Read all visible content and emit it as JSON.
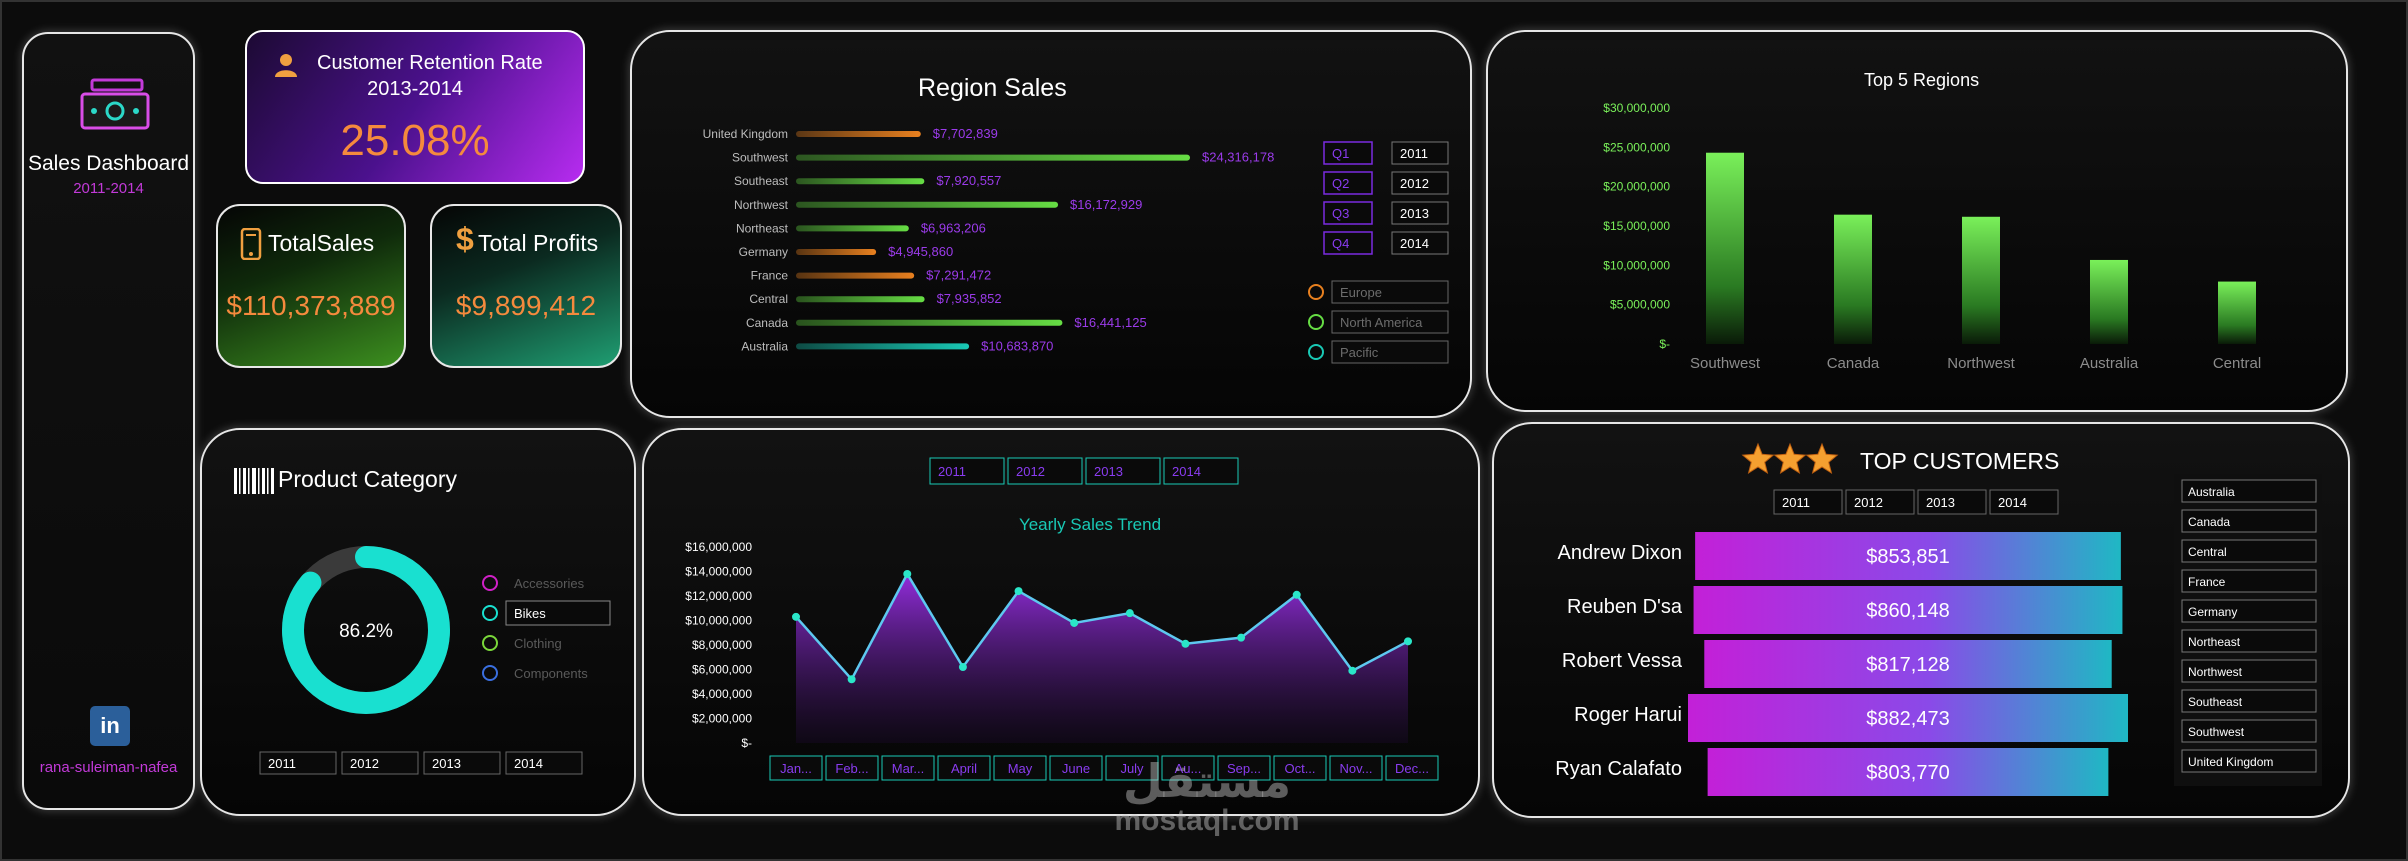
{
  "sidebar": {
    "title": "Sales Dashboard",
    "years": "2011-2014",
    "linkedin": "in",
    "user": "rana-suleiman-nafea"
  },
  "kpis": {
    "retention": {
      "title": "Customer Retention Rate",
      "sub": "2013-2014",
      "value": "25.08%"
    },
    "sales": {
      "title": "TotalSales",
      "value": "$110,373,889"
    },
    "profits": {
      "title": "Total Profits",
      "value": "$9,899,412"
    }
  },
  "colors": {
    "purple": "#8a2be2",
    "green": "#66dd44",
    "orange": "#e8801f",
    "teal": "#19c9b5",
    "accent_text": "#9b3bea"
  },
  "chart_data": [
    {
      "id": "region-sales",
      "type": "bar",
      "orientation": "horizontal",
      "title": "Region Sales",
      "categories": [
        "United Kingdom",
        "Southwest",
        "Southeast",
        "Northwest",
        "Northeast",
        "Germany",
        "France",
        "Central",
        "Canada",
        "Australia"
      ],
      "values": [
        7702839,
        24316178,
        7920557,
        16172929,
        6963206,
        4945860,
        7291472,
        7935852,
        16441125,
        10683870
      ],
      "labels": [
        "$7,702,839",
        "$24,316,178",
        "$7,920,557",
        "$16,172,929",
        "$6,963,206",
        "$4,945,860",
        "$7,291,472",
        "$7,935,852",
        "$16,441,125",
        "$10,683,870"
      ],
      "groups": [
        "Europe",
        "North America",
        "North America",
        "North America",
        "North America",
        "Europe",
        "Europe",
        "North America",
        "North America",
        "Pacific"
      ],
      "group_colors": {
        "Europe": "#e8801f",
        "North America": "#66dd44",
        "Pacific": "#19c9b5"
      },
      "slicers": {
        "quarters": [
          "Q1",
          "Q2",
          "Q3",
          "Q4"
        ],
        "years": [
          "2011",
          "2012",
          "2013",
          "2014"
        ],
        "groups": [
          "Europe",
          "North America",
          "Pacific"
        ]
      }
    },
    {
      "id": "top5",
      "type": "bar",
      "title": "Top 5 Regions",
      "categories": [
        "Southwest",
        "Canada",
        "Northwest",
        "Australia",
        "Central"
      ],
      "values": [
        24316178,
        16441125,
        16172929,
        10683870,
        7935852
      ],
      "y_ticks": [
        "$30,000,000",
        "$25,000,000",
        "$20,000,000",
        "$15,000,000",
        "$10,000,000",
        "$5,000,000",
        "$-"
      ],
      "ylim": [
        0,
        30000000
      ]
    },
    {
      "id": "product",
      "type": "pie",
      "title": "Product Category",
      "center_label": "86.2%",
      "value": 86.2,
      "legend": [
        "Accessories",
        "Bikes",
        "Clothing",
        "Components"
      ],
      "legend_colors": [
        "#d020c8",
        "#19e0d0",
        "#7ad83a",
        "#3a6fe0"
      ],
      "selected": "Bikes",
      "years": [
        "2011",
        "2012",
        "2013",
        "2014"
      ]
    },
    {
      "id": "yearly",
      "type": "area",
      "title": "Yearly Sales Trend",
      "categories": [
        "Jan...",
        "Feb...",
        "Mar...",
        "April",
        "May",
        "June",
        "July",
        "Au...",
        "Sep...",
        "Oct...",
        "Nov...",
        "Dec..."
      ],
      "values": [
        10300000,
        5200000,
        13800000,
        6200000,
        12400000,
        9800000,
        10600000,
        8100000,
        8600000,
        12100000,
        5900000,
        8300000
      ],
      "y_ticks": [
        "$16,000,000",
        "$14,000,000",
        "$12,000,000",
        "$10,000,000",
        "$8,000,000",
        "$6,000,000",
        "$4,000,000",
        "$2,000,000",
        "$-"
      ],
      "ylim": [
        0,
        16000000
      ],
      "years": [
        "2011",
        "2012",
        "2013",
        "2014"
      ]
    },
    {
      "id": "customers",
      "type": "bar",
      "orientation": "horizontal",
      "title": "TOP CUSTOMERS",
      "categories": [
        "Andrew Dixon",
        "Reuben D'sa",
        "Robert Vessa",
        "Roger Harui",
        "Ryan Calafato"
      ],
      "values": [
        853851,
        860148,
        817128,
        882473,
        803770
      ],
      "labels": [
        "$853,851",
        "$860,148",
        "$817,128",
        "$882,473",
        "$803,770"
      ],
      "years": [
        "2011",
        "2012",
        "2013",
        "2014"
      ],
      "regions": [
        "Australia",
        "Canada",
        "Central",
        "France",
        "Germany",
        "Northeast",
        "Northwest",
        "Southeast",
        "Southwest",
        "United Kingdom"
      ]
    }
  ],
  "watermark": {
    "arabic": "مستقل",
    "latin": "mostaql.com"
  }
}
